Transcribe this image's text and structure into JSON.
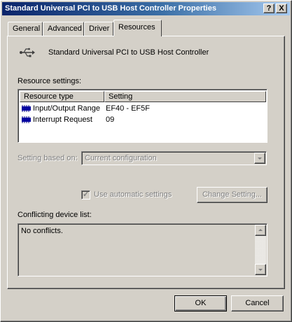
{
  "window": {
    "title": "Standard Universal PCI to USB Host Controller Properties",
    "help_button": "?",
    "close_button": "X"
  },
  "tabs": [
    {
      "label": "General"
    },
    {
      "label": "Advanced"
    },
    {
      "label": "Driver"
    },
    {
      "label": "Resources",
      "active": true
    }
  ],
  "device": {
    "name": "Standard Universal PCI to USB Host Controller",
    "icon": "usb-icon"
  },
  "resource_settings": {
    "label": "Resource settings:",
    "columns": [
      "Resource type",
      "Setting"
    ],
    "rows": [
      {
        "type": "Input/Output Range",
        "setting": "EF40 - EF5F",
        "icon": "chip-icon"
      },
      {
        "type": "Interrupt Request",
        "setting": "09",
        "icon": "chip-icon"
      }
    ]
  },
  "setting_based_on": {
    "label": "Setting based on:",
    "value": "Current configuration"
  },
  "use_automatic": {
    "label": "Use automatic settings",
    "checked": true
  },
  "change_setting_label": "Change Setting...",
  "conflicts": {
    "label": "Conflicting device list:",
    "text": "No conflicts."
  },
  "buttons": {
    "ok": "OK",
    "cancel": "Cancel"
  },
  "colors": {
    "titlebar_start": "#0a246a",
    "titlebar_end": "#a6caf0",
    "face": "#d4d0c8",
    "chip": "#0000a0"
  }
}
